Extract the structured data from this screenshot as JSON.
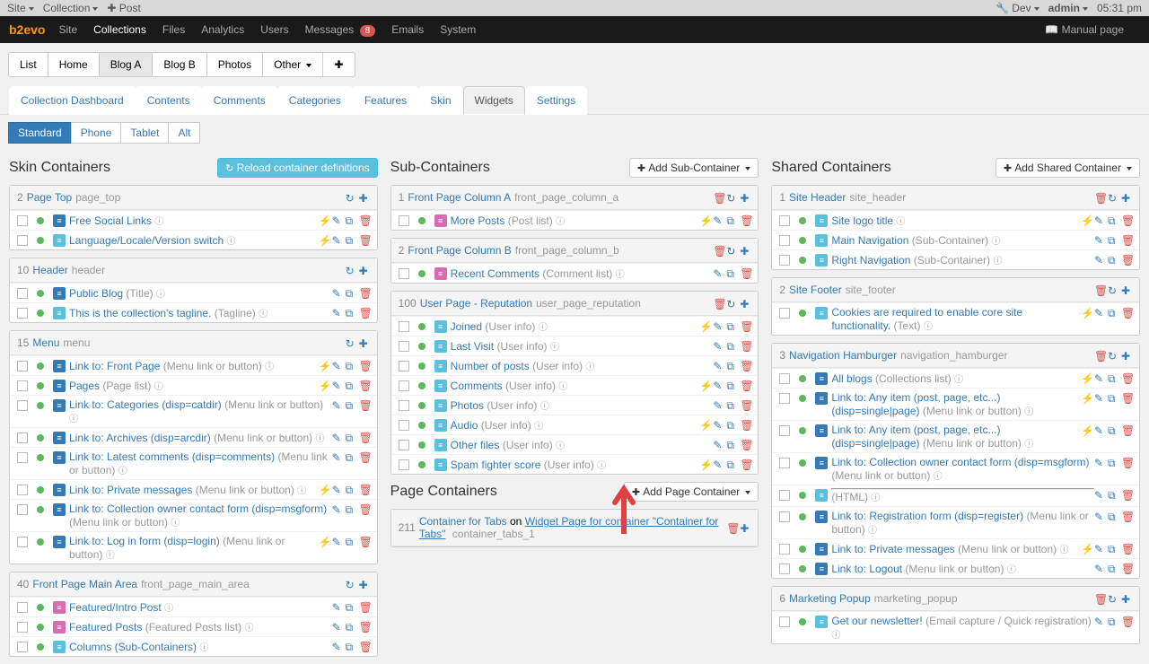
{
  "topbar": {
    "site": "Site",
    "collection": "Collection",
    "post": "Post",
    "dev": "Dev",
    "user": "admin",
    "time": "05:31 pm"
  },
  "mainnav": {
    "brand": "b2evo",
    "items": [
      "Site",
      "Collections",
      "Files",
      "Analytics",
      "Users",
      "Messages",
      "Emails",
      "System"
    ],
    "msg_count": "8",
    "manual": "Manual page"
  },
  "subnav": [
    "List",
    "Home",
    "Blog A",
    "Blog B",
    "Photos",
    "Other"
  ],
  "tabs": [
    "Collection Dashboard",
    "Contents",
    "Comments",
    "Categories",
    "Features",
    "Skin",
    "Widgets",
    "Settings"
  ],
  "filter": [
    "Standard",
    "Phone",
    "Tablet",
    "Alt"
  ],
  "col_l": {
    "title": "Skin Containers",
    "reload": "Reload container definitions",
    "panels": [
      {
        "num": "2",
        "name": "Page Top",
        "slug": "page_top",
        "rows": [
          {
            "label": "Free Social Links",
            "meta": "",
            "ico": "blue",
            "bolt": true
          },
          {
            "label": "Language/Locale/Version switch",
            "meta": "",
            "ico": "teal",
            "bolt": true
          }
        ]
      },
      {
        "num": "10",
        "name": "Header",
        "slug": "header",
        "rows": [
          {
            "label": "Public Blog",
            "meta": "(Title)",
            "ico": "blue"
          },
          {
            "label": "This is the collection's tagline.",
            "meta": "(Tagline)",
            "ico": "teal"
          }
        ]
      },
      {
        "num": "15",
        "name": "Menu",
        "slug": "menu",
        "rows": [
          {
            "label": "Link to: Front Page",
            "meta": "(Menu link or button)",
            "ico": "blue",
            "bolt": true
          },
          {
            "label": "Pages",
            "meta": "(Page list)",
            "ico": "blue",
            "bolt": true
          },
          {
            "label": "Link to: Categories (disp=catdir)",
            "meta": "(Menu link or button)",
            "ico": "blue"
          },
          {
            "label": "Link to: Archives (disp=arcdir)",
            "meta": "(Menu link or button)",
            "ico": "blue"
          },
          {
            "label": "Link to: Latest comments (disp=comments)",
            "meta": "(Menu link or button)",
            "ico": "blue"
          },
          {
            "label": "Link to: Private messages",
            "meta": "(Menu link or button)",
            "ico": "blue",
            "bolt": true
          },
          {
            "label": "Link to: Collection owner contact form (disp=msgform)",
            "meta": "(Menu link or button)",
            "ico": "blue"
          },
          {
            "label": "Link to: Log in form (disp=login)",
            "meta": "(Menu link or button)",
            "ico": "blue",
            "bolt": true
          }
        ]
      },
      {
        "num": "40",
        "name": "Front Page Main Area",
        "slug": "front_page_main_area",
        "rows": [
          {
            "label": "Featured/Intro Post",
            "meta": "",
            "ico": "pink"
          },
          {
            "label": "Featured Posts",
            "meta": "(Featured Posts list)",
            "ico": "pink"
          },
          {
            "label": "Columns (Sub-Containers)",
            "meta": "",
            "ico": "teal"
          }
        ]
      }
    ]
  },
  "col_m": {
    "title": "Sub-Containers",
    "add": "Add Sub-Container",
    "panels": [
      {
        "num": "1",
        "name": "Front Page Column A",
        "slug": "front_page_column_a",
        "rows": [
          {
            "label": "More Posts",
            "meta": "(Post list)",
            "ico": "pink",
            "bolt": true
          }
        ]
      },
      {
        "num": "2",
        "name": "Front Page Column B",
        "slug": "front_page_column_b",
        "rows": [
          {
            "label": "Recent Comments",
            "meta": "(Comment list)",
            "ico": "pink"
          }
        ]
      },
      {
        "num": "100",
        "name": "User Page - Reputation",
        "slug": "user_page_reputation",
        "rows": [
          {
            "label": "Joined",
            "meta": "(User info)",
            "ico": "teal",
            "bolt": true
          },
          {
            "label": "Last Visit",
            "meta": "(User info)",
            "ico": "teal"
          },
          {
            "label": "Number of posts",
            "meta": "(User info)",
            "ico": "teal"
          },
          {
            "label": "Comments",
            "meta": "(User info)",
            "ico": "teal",
            "bolt": true
          },
          {
            "label": "Photos",
            "meta": "(User info)",
            "ico": "teal"
          },
          {
            "label": "Audio",
            "meta": "(User info)",
            "ico": "teal",
            "bolt": true
          },
          {
            "label": "Other files",
            "meta": "(User info)",
            "ico": "teal"
          },
          {
            "label": "Spam fighter score",
            "meta": "(User info)",
            "ico": "teal",
            "bolt": true
          }
        ]
      }
    ],
    "page_title": "Page Containers",
    "page_add": "Add Page Container",
    "page_panel": {
      "num": "211",
      "name": "Container for Tabs",
      "on": "on",
      "link": "Widget Page for container \"Container for Tabs\"",
      "slug": "container_tabs_1"
    }
  },
  "col_r": {
    "title": "Shared Containers",
    "add": "Add Shared Container",
    "panels": [
      {
        "num": "1",
        "name": "Site Header",
        "slug": "site_header",
        "rows": [
          {
            "label": "Site logo title",
            "meta": "",
            "ico": "teal",
            "cache": true
          },
          {
            "label": "Main Navigation",
            "meta": "(Sub-Container)",
            "ico": "teal"
          },
          {
            "label": "Right Navigation",
            "meta": "(Sub-Container)",
            "ico": "teal"
          }
        ]
      },
      {
        "num": "2",
        "name": "Site Footer",
        "slug": "site_footer",
        "rows": [
          {
            "label": "Cookies are required to enable core site functionality.",
            "meta": "(Text)",
            "ico": "teal",
            "cache": true
          }
        ]
      },
      {
        "num": "3",
        "name": "Navigation Hamburger",
        "slug": "navigation_hamburger",
        "rows": [
          {
            "label": "All blogs",
            "meta": "(Collections list)",
            "ico": "blue",
            "cache": true
          },
          {
            "label": "Link to: Any item (post, page, etc...) (disp=single|page)",
            "meta": "(Menu link or button)",
            "ico": "blue",
            "boltred": true
          },
          {
            "label": "Link to: Any item (post, page, etc...) (disp=single|page)",
            "meta": "(Menu link or button)",
            "ico": "blue",
            "boltred": true
          },
          {
            "label": "Link to: Collection owner contact form (disp=msgform)",
            "meta": "(Menu link or button)",
            "ico": "blue"
          },
          {
            "label": "<hr class=\"visible-xs\" />",
            "meta": "(HTML)",
            "ico": "teal"
          },
          {
            "label": "Link to: Registration form (disp=register)",
            "meta": "(Menu link or button)",
            "ico": "blue"
          },
          {
            "label": "Link to: Private messages",
            "meta": "(Menu link or button)",
            "ico": "blue",
            "bolt": true
          },
          {
            "label": "Link to: Logout",
            "meta": "(Menu link or button)",
            "ico": "blue"
          }
        ]
      },
      {
        "num": "6",
        "name": "Marketing Popup",
        "slug": "marketing_popup",
        "rows": [
          {
            "label": "Get our newsletter!",
            "meta": "(Email capture / Quick registration)",
            "ico": "teal"
          }
        ]
      }
    ]
  }
}
